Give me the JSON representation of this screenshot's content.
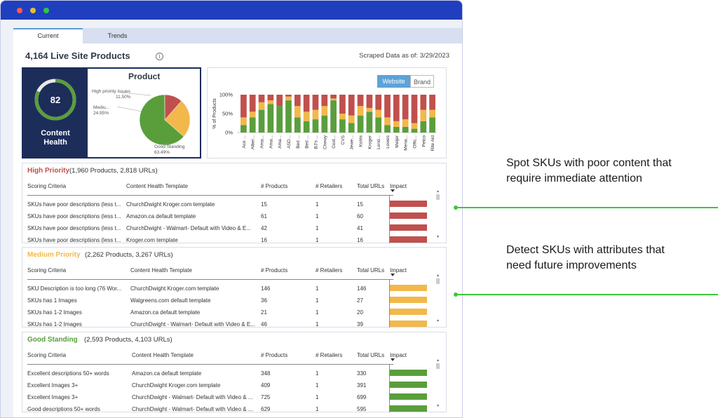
{
  "tabs": [
    {
      "label": "Current"
    },
    {
      "label": "Trends"
    }
  ],
  "header": {
    "title": "4,164 Live Site Products",
    "scraped": "Scraped Data as of: 3/29/2023"
  },
  "health": {
    "score": "82",
    "label_line1": "Content",
    "label_line2": "Health",
    "ring_fraction": 0.82,
    "ring_color": "#5a9e3c"
  },
  "product_pie": {
    "title": "Product",
    "slices": [
      {
        "label": "High priority issues",
        "value": "11.50%",
        "pct": 11.5,
        "color": "#c0504d"
      },
      {
        "label": "Mediu...",
        "value": "24.95%",
        "pct": 24.95,
        "color": "#f2b84b"
      },
      {
        "label": "Good Standing",
        "value": "63.49%",
        "pct": 63.49,
        "color": "#5a9e3c"
      }
    ]
  },
  "toggle": {
    "website": "Website",
    "brand": "Brand"
  },
  "chart_data": {
    "type": "bar",
    "stacked": true,
    "ylabel": "% of Products",
    "yticks": [
      "100%",
      "50%",
      "0%"
    ],
    "ylim": [
      0,
      100
    ],
    "categories": [
      "Ace ...",
      "Alber...",
      "Ama...",
      "Ama...",
      "Ama...",
      "ASD...",
      "Bed ...",
      "Bed ...",
      "BJ's ...",
      "Chewy",
      "Cost...",
      "CVS",
      "Jewe...",
      "Kohls",
      "Kroger",
      "Lond...",
      "Lowes",
      "Meijer",
      "Mena...",
      "Offic...",
      "Petco",
      "Rite Aid"
    ],
    "series": [
      {
        "color": "#5a9e3c",
        "values": [
          20,
          40,
          60,
          75,
          70,
          85,
          40,
          30,
          35,
          45,
          85,
          35,
          25,
          45,
          55,
          40,
          20,
          15,
          15,
          10,
          30,
          40
        ]
      },
      {
        "color": "#f2b84b",
        "values": [
          20,
          15,
          20,
          10,
          0,
          10,
          30,
          25,
          25,
          25,
          5,
          15,
          20,
          25,
          10,
          20,
          20,
          15,
          20,
          15,
          30,
          20
        ]
      },
      {
        "color": "#c0504d",
        "values": [
          60,
          45,
          20,
          15,
          30,
          5,
          30,
          45,
          40,
          30,
          10,
          50,
          55,
          30,
          35,
          40,
          60,
          70,
          65,
          75,
          40,
          40
        ]
      }
    ]
  },
  "sections": [
    {
      "title": "High Priority",
      "subtitle": "(1,960 Products, 2,818 URLs)",
      "color": "#c0504d",
      "headers": [
        "Scoring Criteria",
        "Content Health Template",
        "# Products",
        "# Retailers",
        "Total URLs",
        "Impact"
      ],
      "rows": [
        {
          "criteria": "SKUs have poor descriptions (less t...",
          "template": "ChurchDwight Kroger.com template",
          "products": "15",
          "retailers": "1",
          "urls": "15",
          "impact": 1.0
        },
        {
          "criteria": "SKUs have poor descriptions (less t...",
          "template": "Amazon.ca default template",
          "products": "61",
          "retailers": "1",
          "urls": "60",
          "impact": 1.0
        },
        {
          "criteria": "SKUs have poor descriptions (less t...",
          "template": "ChurchDwight - Walmart- Default with Video & E...",
          "products": "42",
          "retailers": "1",
          "urls": "41",
          "impact": 1.0
        },
        {
          "criteria": "SKUs have poor descriptions (less t...",
          "template": "Kroger.com template",
          "products": "16",
          "retailers": "1",
          "urls": "16",
          "impact": 1.0
        }
      ]
    },
    {
      "title": "Medium Priority",
      "subtitle": "(2,262 Products, 3,267 URLs)",
      "color": "#f2b84b",
      "headers": [
        "Scoring Criteria",
        "Content Health Template",
        "# Products",
        "# Retailers",
        "Total URLs",
        "Impact"
      ],
      "rows": [
        {
          "criteria": "SKU Description is too long (76 Wor...",
          "template": "ChurchDwight Kroger.com template",
          "products": "146",
          "retailers": "1",
          "urls": "146",
          "impact": 1.0
        },
        {
          "criteria": "SKUs has 1 Images",
          "template": "Walgreens.com default template",
          "products": "36",
          "retailers": "1",
          "urls": "27",
          "impact": 1.0
        },
        {
          "criteria": "SKUs has 1-2 Images",
          "template": "Amazon.ca default template",
          "products": "21",
          "retailers": "1",
          "urls": "20",
          "impact": 1.0
        },
        {
          "criteria": "SKUs has 1-2 Images",
          "template": "ChurchDwight - Walmart- Default with Video & E...",
          "products": "46",
          "retailers": "1",
          "urls": "39",
          "impact": 1.0
        }
      ]
    },
    {
      "title": "Good Standing",
      "subtitle": "(2,593 Products, 4,103 URLs)",
      "color": "#5a9e3c",
      "headers": [
        "Scoring Criteria",
        "Content Health Template",
        "# Products",
        "# Retailers",
        "Total URLs",
        "Impact"
      ],
      "rows": [
        {
          "criteria": "Excellent descriptions 50+ words",
          "template": "Amazon.ca default template",
          "products": "348",
          "retailers": "1",
          "urls": "330",
          "impact": 1.0
        },
        {
          "criteria": "Excellent Images 3+",
          "template": "ChurchDwight Kroger.com template",
          "products": "409",
          "retailers": "1",
          "urls": "391",
          "impact": 1.0
        },
        {
          "criteria": "Excellent Images 3+",
          "template": "ChurchDwight - Walmart- Default with Video & ...",
          "products": "725",
          "retailers": "1",
          "urls": "699",
          "impact": 1.0
        },
        {
          "criteria": "Good descriptions  50+ words",
          "template": "ChurchDwight - Walmart- Default with Video & ...",
          "products": "629",
          "retailers": "1",
          "urls": "595",
          "impact": 1.0
        }
      ]
    }
  ],
  "callouts": [
    {
      "line1": "Spot SKUs with poor content that",
      "line2": "require immediate attention"
    },
    {
      "line1": "Detect SKUs with attributes that",
      "line2": "need future improvements"
    }
  ]
}
